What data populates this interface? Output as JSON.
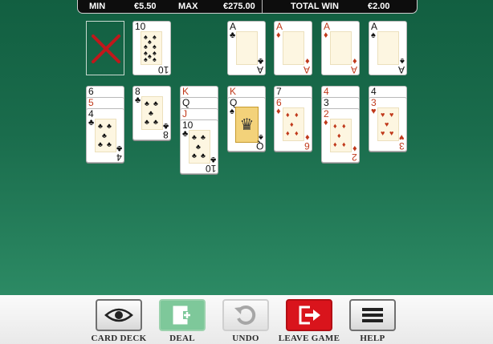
{
  "stats": {
    "min_label": "MIN",
    "min_value": "€5.50",
    "max_label": "MAX",
    "max_value": "€275.00",
    "total_win_label": "TOTAL WIN",
    "total_win_value": "€2.00"
  },
  "stock": {
    "status_icon": "red-x-icon",
    "color": "#c0181b"
  },
  "foundations": [
    {
      "rank": "A",
      "suit": "♣",
      "color": "black"
    },
    {
      "rank": "A",
      "suit": "♦",
      "color": "red"
    },
    {
      "rank": "A",
      "suit": "♦",
      "color": "red"
    },
    {
      "rank": "A",
      "suit": "♠",
      "color": "black"
    }
  ],
  "waste": {
    "rank": "10",
    "suit": "♠",
    "color": "black"
  },
  "tableau": [
    {
      "ranks": [
        "6",
        "5",
        "4"
      ],
      "suits": [
        "♠",
        "♥",
        "♣"
      ],
      "colors": [
        "black",
        "red",
        "black"
      ]
    },
    {
      "ranks": [
        "8"
      ],
      "suits": [
        "♣"
      ],
      "colors": [
        "black"
      ]
    },
    {
      "ranks": [
        "K",
        "Q",
        "J",
        "10"
      ],
      "suits": [
        "♦",
        "♠",
        "♦",
        "♣"
      ],
      "colors": [
        "red",
        "black",
        "red",
        "black"
      ]
    },
    {
      "ranks": [
        "K",
        "Q"
      ],
      "suits": [
        "♠",
        "♠"
      ],
      "colors": [
        "red",
        "black"
      ]
    },
    {
      "ranks": [
        "7",
        "6"
      ],
      "suits": [
        "♠",
        "♦"
      ],
      "colors": [
        "black",
        "red"
      ]
    },
    {
      "ranks": [
        "4",
        "3",
        "2"
      ],
      "suits": [
        "♠",
        "♠",
        "♦"
      ],
      "colors": [
        "red",
        "black",
        "red"
      ]
    },
    {
      "ranks": [
        "4",
        "3"
      ],
      "suits": [
        "♠",
        "♥"
      ],
      "colors": [
        "black",
        "red"
      ]
    }
  ],
  "buttons": [
    {
      "label": "CARD DECK",
      "icon": "eye-icon"
    },
    {
      "label": "DEAL",
      "icon": "deal-card-icon"
    },
    {
      "label": "UNDO",
      "icon": "undo-icon"
    },
    {
      "label": "LEAVE GAME",
      "icon": "exit-arrow-icon"
    },
    {
      "label": "HELP",
      "icon": "menu-icon"
    }
  ],
  "colors": {
    "felt": "#1a6c4c",
    "deal_button": "#7ec89a",
    "leave_button": "#d9141c",
    "card_red": "#c0391b"
  }
}
